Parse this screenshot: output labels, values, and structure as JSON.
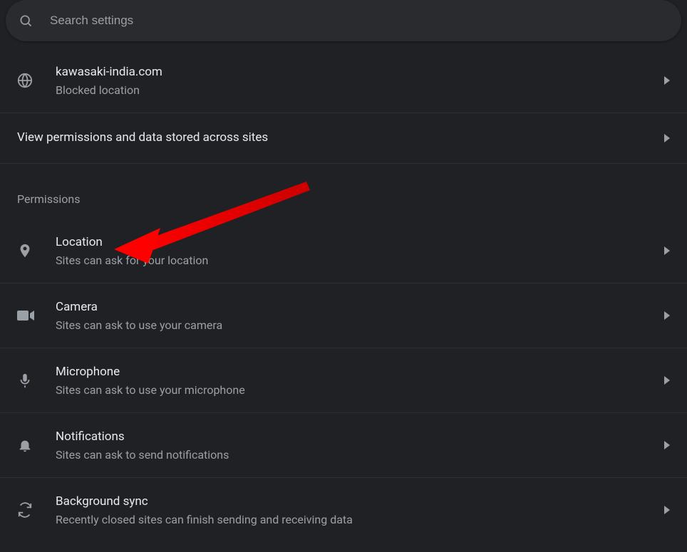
{
  "search": {
    "placeholder": "Search settings"
  },
  "recent": {
    "site": "kawasaki-india.com",
    "status": "Blocked location"
  },
  "view_all": {
    "label": "View permissions and data stored across sites"
  },
  "section_title": "Permissions",
  "permissions": [
    {
      "title": "Location",
      "subtitle": "Sites can ask for your location"
    },
    {
      "title": "Camera",
      "subtitle": "Sites can ask to use your camera"
    },
    {
      "title": "Microphone",
      "subtitle": "Sites can ask to use your microphone"
    },
    {
      "title": "Notifications",
      "subtitle": "Sites can ask to send notifications"
    },
    {
      "title": "Background sync",
      "subtitle": "Recently closed sites can finish sending and receiving data"
    }
  ]
}
